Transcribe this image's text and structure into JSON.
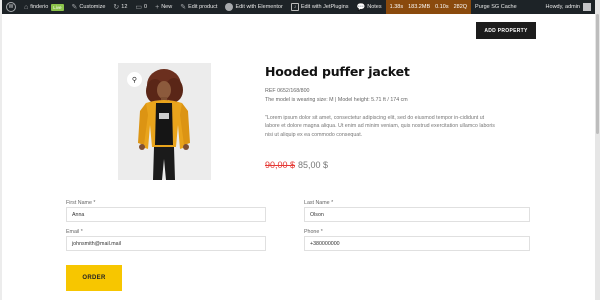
{
  "admin_bar": {
    "site_name": "finderio",
    "live_badge": "Live",
    "customize": "Customize",
    "revisions_count": "12",
    "comments_count": "0",
    "new": "New",
    "edit_product": "Edit product",
    "edit_elementor": "Edit with Elementor",
    "edit_jetplugins": "Edit with JetPlugins",
    "notes": "Notes",
    "qm_time": "1.38s",
    "qm_memory": "183.2MB",
    "qm_db_time": "0.10s",
    "qm_queries": "282Q",
    "purge_cache": "Purge SG Cache",
    "howdy": "Howdy, admin"
  },
  "header": {
    "add_property": "ADD PROPERTY"
  },
  "product": {
    "title": "Hooded puffer jacket",
    "ref": "REF 0652/168/800",
    "model_info": "The model is wearing size: M | Model height: 5.71 ft / 174 cm",
    "description": "\"Lorem ipsum dolor sit amet, consectetur adipiscing elit, sed do eiusmod tempor in-cididunt ut labore et dolore magna aliqua. Ut enim ad minim veniam, quis nostrud exercitation ullamco laboris nisi ut aliquip ex ea commodo consequat.",
    "old_price": "90,00 $",
    "new_price": "85,00 $"
  },
  "form": {
    "first_name_label": "First Name *",
    "first_name_value": "Anna",
    "last_name_label": "Last Name *",
    "last_name_value": "Olson",
    "email_label": "Email *",
    "email_value": "johnsmith@mail.mail",
    "phone_label": "Phone *",
    "phone_value": "+380000000",
    "order_button": "ORDER"
  },
  "icons": {
    "wordpress": "wordpress-icon",
    "customize": "brush-icon",
    "revisions": "refresh-icon",
    "comments": "comment-icon",
    "new": "plus-icon",
    "edit": "pencil-icon",
    "zoom": "search-icon"
  },
  "colors": {
    "admin_bar": "#1d2327",
    "accent_yellow": "#f7c600",
    "old_price_red": "#e53935",
    "dark_button": "#1c1c1c"
  }
}
